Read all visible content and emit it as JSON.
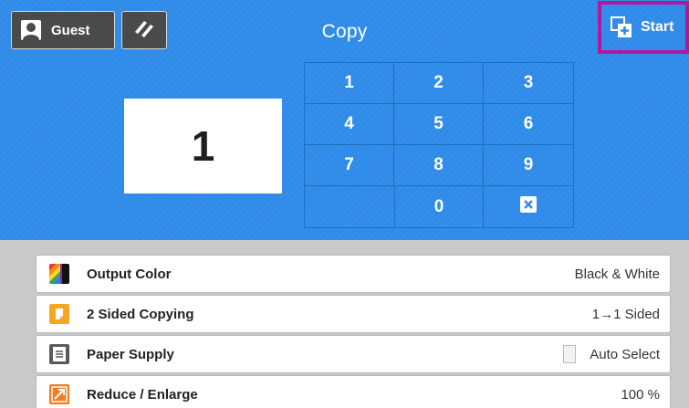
{
  "header": {
    "user_label": "Guest",
    "title": "Copy",
    "start_label": "Start"
  },
  "copy_count": "1",
  "keypad": {
    "keys": [
      "1",
      "2",
      "3",
      "4",
      "5",
      "6",
      "7",
      "8",
      "9",
      "0"
    ],
    "clear_icon": "clear-x-icon"
  },
  "settings": [
    {
      "label": "Output Color",
      "value": "Black & White",
      "icon": "output-color-icon"
    },
    {
      "label": "2 Sided Copying",
      "value": "1→1 Sided",
      "icon": "two-sided-icon"
    },
    {
      "label": "Paper Supply",
      "value": "Auto Select",
      "icon": "paper-supply-icon"
    },
    {
      "label": "Reduce / Enlarge",
      "value": "100 %",
      "icon": "reduce-enlarge-icon"
    }
  ],
  "colors": {
    "header_blue": "#2f8be8",
    "start_highlight": "#b5179c",
    "two_sided_orange": "#f5a623",
    "reduce_orange": "#f07d1f"
  }
}
